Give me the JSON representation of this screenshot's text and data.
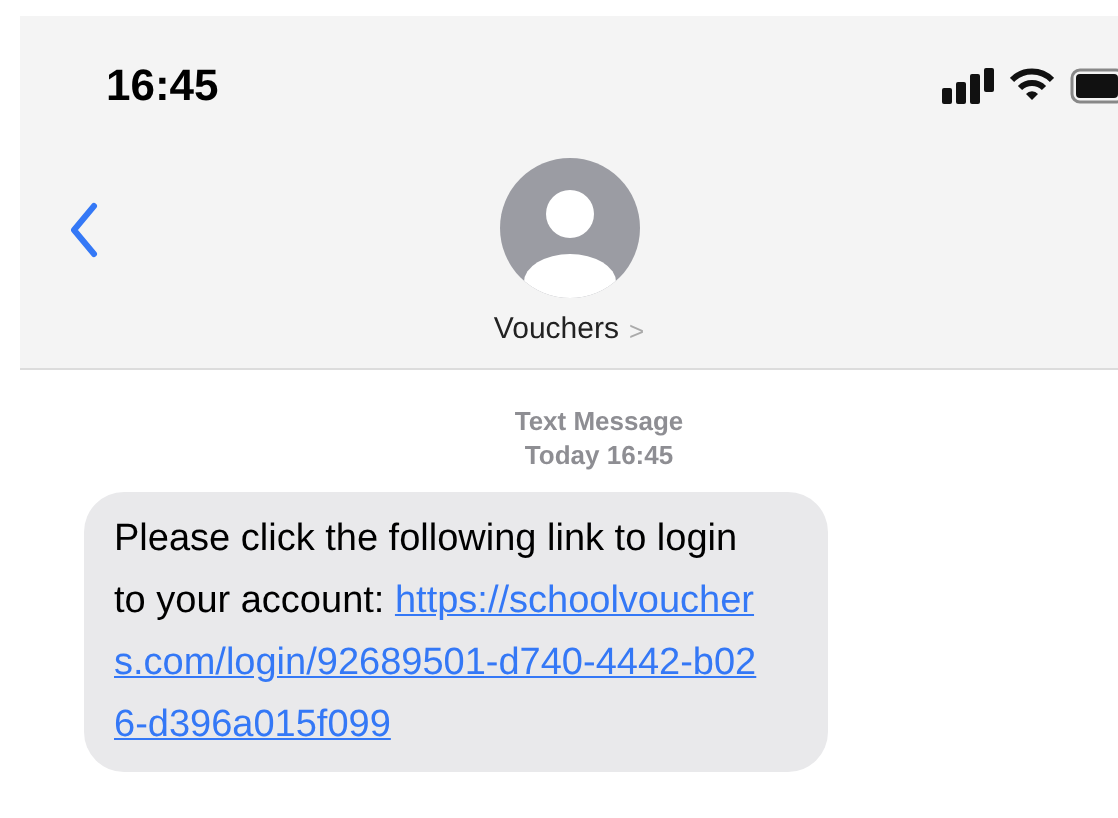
{
  "status_bar": {
    "time": "16:45"
  },
  "header": {
    "contact_name": "Vouchers",
    "chevron": ">"
  },
  "thread": {
    "service": "Text Message",
    "timestamp": "Today 16:45"
  },
  "messages": [
    {
      "text": "Please click the following link to login to your account:",
      "link": "https://schoolvouchers.com/login/92689501-d740-4442-b026-d396a015f099"
    }
  ]
}
